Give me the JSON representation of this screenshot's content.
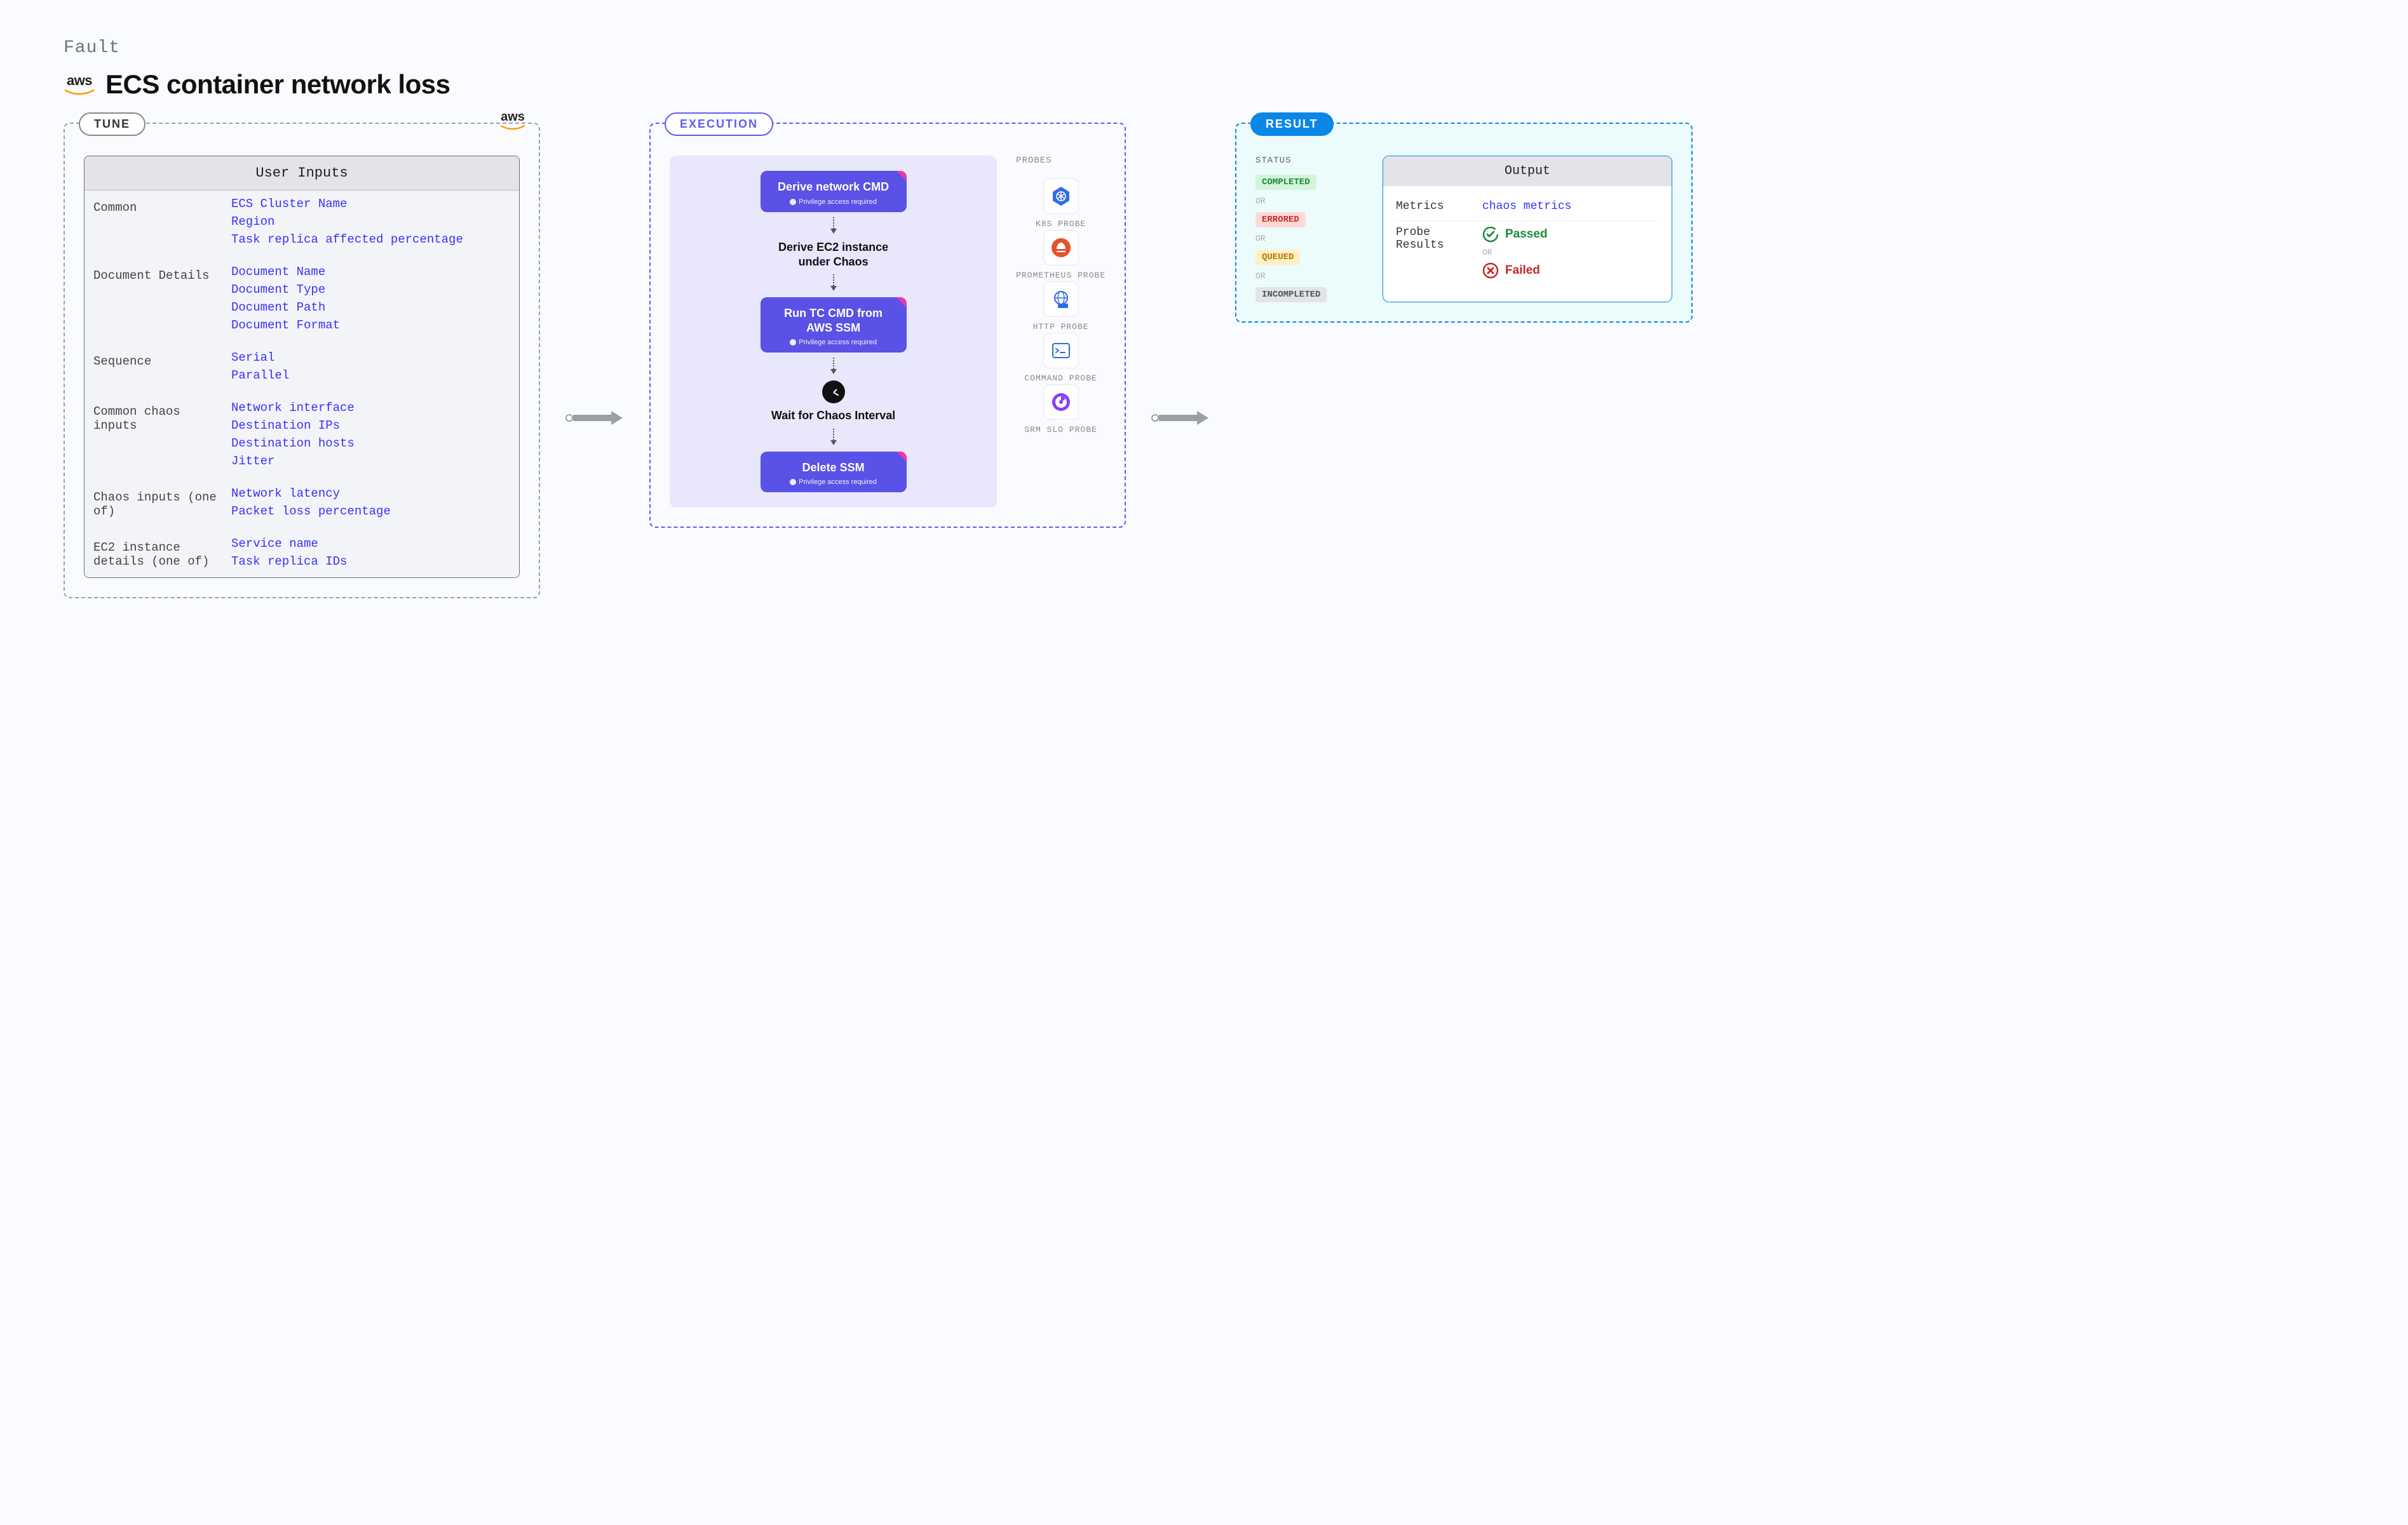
{
  "header": {
    "fault_label": "Fault",
    "title": "ECS container network loss",
    "vendor": "aws"
  },
  "tune": {
    "tag": "TUNE",
    "corner_vendor": "aws",
    "inputs_header": "User Inputs",
    "sections": [
      {
        "label": "Common",
        "items": [
          "ECS Cluster Name",
          "Region",
          "Task replica affected percentage"
        ]
      },
      {
        "label": "Document Details",
        "items": [
          "Document Name",
          "Document Type",
          "Document Path",
          "Document Format"
        ]
      },
      {
        "label": "Sequence",
        "items": [
          "Serial",
          "Parallel"
        ]
      },
      {
        "label": "Common chaos inputs",
        "items": [
          "Network interface",
          "Destination IPs",
          "Destination hosts",
          "Jitter"
        ]
      },
      {
        "label": "Chaos inputs (one of)",
        "items": [
          "Network latency",
          "Packet loss percentage"
        ]
      },
      {
        "label": "EC2 instance details (one of)",
        "items": [
          "Service name",
          "Task replica IDs"
        ]
      }
    ]
  },
  "execution": {
    "tag": "EXECUTION",
    "priv_text": "Privilege access required",
    "steps": [
      {
        "type": "card",
        "title": "Derive network CMD",
        "priv": true
      },
      {
        "type": "plain",
        "title": "Derive EC2 instance under Chaos"
      },
      {
        "type": "card",
        "title": "Run TC CMD from AWS SSM",
        "priv": true
      },
      {
        "type": "clock",
        "title": "Wait for Chaos Interval"
      },
      {
        "type": "card",
        "title": "Delete SSM",
        "priv": true
      }
    ],
    "probes_label": "PROBES",
    "probes": [
      {
        "name": "K8S PROBE",
        "icon": "k8s"
      },
      {
        "name": "PROMETHEUS PROBE",
        "icon": "prom"
      },
      {
        "name": "HTTP PROBE",
        "icon": "http"
      },
      {
        "name": "COMMAND PROBE",
        "icon": "cmd"
      },
      {
        "name": "SRM SLO PROBE",
        "icon": "slo"
      }
    ]
  },
  "result": {
    "tag": "RESULT",
    "status_label": "STATUS",
    "or_label": "OR",
    "statuses": [
      {
        "text": "COMPLETED",
        "cls": "badge-green"
      },
      {
        "text": "ERRORED",
        "cls": "badge-red"
      },
      {
        "text": "QUEUED",
        "cls": "badge-yellow"
      },
      {
        "text": "INCOMPLETED",
        "cls": "badge-grey"
      }
    ],
    "output_header": "Output",
    "metrics_label": "Metrics",
    "metrics_link": "chaos metrics",
    "probe_results_label": "Probe Results",
    "passed_label": "Passed",
    "failed_label": "Failed"
  }
}
